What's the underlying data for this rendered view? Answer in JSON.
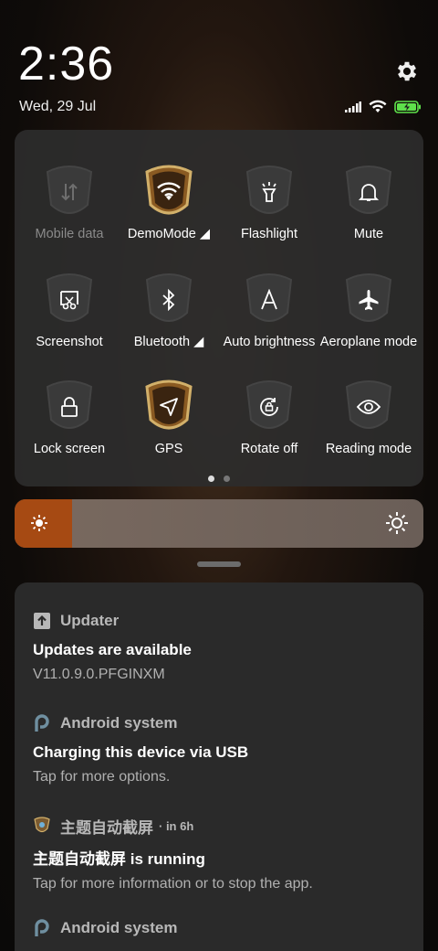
{
  "header": {
    "time": "2:36",
    "date": "Wed, 29 Jul"
  },
  "quick_settings": {
    "tiles": [
      {
        "label": "Mobile data",
        "icon": "mobile-data-icon",
        "active": false,
        "disabled": true
      },
      {
        "label": "DemoMode ◢",
        "icon": "wifi-icon",
        "active": true
      },
      {
        "label": "Flashlight",
        "icon": "flashlight-icon",
        "active": false
      },
      {
        "label": "Mute",
        "icon": "bell-icon",
        "active": false
      },
      {
        "label": "Screenshot",
        "icon": "screenshot-icon",
        "active": false
      },
      {
        "label": "Bluetooth ◢",
        "icon": "bluetooth-icon",
        "active": false
      },
      {
        "label": "Auto brightness",
        "icon": "auto-brightness-icon",
        "active": false
      },
      {
        "label": "Aeroplane mode",
        "icon": "airplane-icon",
        "active": false
      },
      {
        "label": "Lock screen",
        "icon": "lock-icon",
        "active": false
      },
      {
        "label": "GPS",
        "icon": "location-icon",
        "active": true
      },
      {
        "label": "Rotate off",
        "icon": "rotate-lock-icon",
        "active": false
      },
      {
        "label": "Reading mode",
        "icon": "eye-icon",
        "active": false
      }
    ],
    "page_count": 2,
    "current_page": 1
  },
  "brightness": {
    "level": 0.14,
    "accent": "#a64a13"
  },
  "notifications": [
    {
      "app": "Updater",
      "when": "",
      "title": "Updates are available",
      "text": "V11.0.9.0.PFGINXM",
      "icon": "upload-icon"
    },
    {
      "app": "Android system",
      "when": "",
      "title": "Charging this device via USB",
      "text": "Tap for more options.",
      "icon": "android-p-icon"
    },
    {
      "app": "主题自动截屏",
      "when": "· in 6h",
      "title": "主题自动截屏 is running",
      "text": "Tap for more information or to stop the app.",
      "icon": "theme-app-icon"
    },
    {
      "app": "Android system",
      "when": "",
      "title": "",
      "text": "",
      "icon": "android-p-icon"
    }
  ],
  "colors": {
    "badge_gold": "#c9a25a",
    "battery_green": "#5ee14b"
  }
}
